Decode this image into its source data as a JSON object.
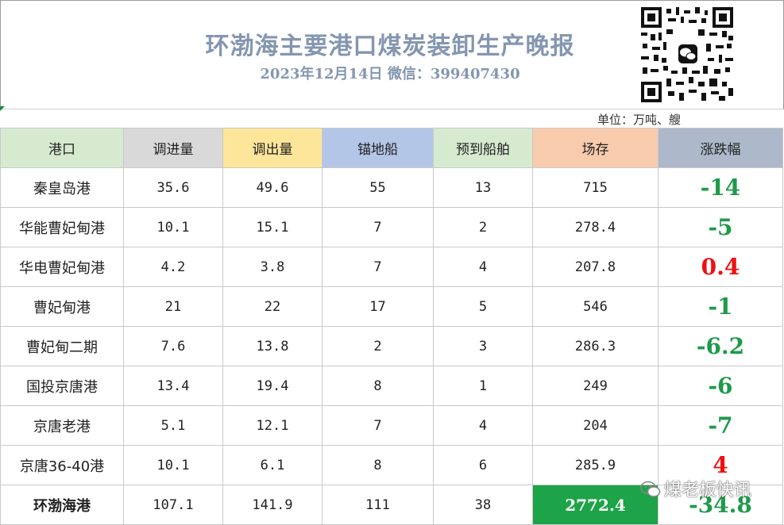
{
  "header": {
    "title": "环渤海主要港口煤炭装卸生产晚报",
    "subtitle": "2023年12月14日  微信：399407430"
  },
  "unit": "单位：万吨、艘",
  "columns": [
    "港口",
    "调进量",
    "调出量",
    "锚地船",
    "预到船舶",
    "场存",
    "涨跌幅"
  ],
  "rows": [
    {
      "port": "秦皇岛港",
      "in": "35.6",
      "out": "49.6",
      "anchor": "55",
      "expect": "13",
      "stock": "715",
      "change": "-14",
      "dir": "down"
    },
    {
      "port": "华能曹妃甸港",
      "in": "10.1",
      "out": "15.1",
      "anchor": "7",
      "expect": "2",
      "stock": "278.4",
      "change": "-5",
      "dir": "down"
    },
    {
      "port": "华电曹妃甸港",
      "in": "4.2",
      "out": "3.8",
      "anchor": "7",
      "expect": "4",
      "stock": "207.8",
      "change": "0.4",
      "dir": "up"
    },
    {
      "port": "曹妃甸港",
      "in": "21",
      "out": "22",
      "anchor": "17",
      "expect": "5",
      "stock": "546",
      "change": "-1",
      "dir": "down"
    },
    {
      "port": "曹妃甸二期",
      "in": "7.6",
      "out": "13.8",
      "anchor": "2",
      "expect": "3",
      "stock": "286.3",
      "change": "-6.2",
      "dir": "down"
    },
    {
      "port": "国投京唐港",
      "in": "13.4",
      "out": "19.4",
      "anchor": "8",
      "expect": "1",
      "stock": "249",
      "change": "-6",
      "dir": "down"
    },
    {
      "port": "京唐老港",
      "in": "5.1",
      "out": "12.1",
      "anchor": "7",
      "expect": "4",
      "stock": "204",
      "change": "-7",
      "dir": "down"
    },
    {
      "port": "京唐36-40港",
      "in": "10.1",
      "out": "6.1",
      "anchor": "8",
      "expect": "6",
      "stock": "285.9",
      "change": "4",
      "dir": "up"
    }
  ],
  "total": {
    "port": "环渤海港",
    "in": "107.1",
    "out": "141.9",
    "anchor": "111",
    "expect": "38",
    "stock": "2772.4",
    "change": "-34.8",
    "dir": "down"
  },
  "watermark": "煤老板快讯",
  "icons": {
    "qr": "wechat-qr-code-icon",
    "watermark": "wechat-icon"
  }
}
